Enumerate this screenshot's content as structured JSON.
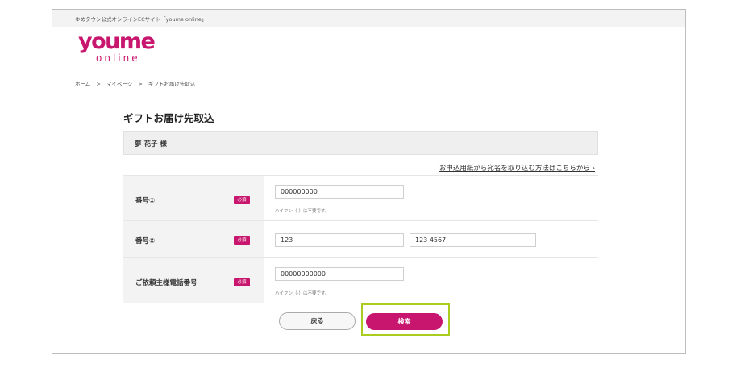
{
  "site": {
    "description": "ゆめタウン公式オンラインECサイト「youme online」",
    "logo_main": "youme",
    "logo_sub": "online"
  },
  "breadcrumb": {
    "items": [
      "ホーム",
      ">",
      "マイページ",
      ">",
      "ギフトお届け先取込"
    ]
  },
  "page": {
    "title": "ギフトお届け先取込",
    "customer_name": "夢 花子 様",
    "import_link": "お申込用紙から宛名を取り込む方法はこちらから ›"
  },
  "form": {
    "required_label": "必須",
    "number1": {
      "label": "番号①",
      "value": "000000000",
      "hint": "ハイフン（-）は不要です。"
    },
    "number2": {
      "label": "番号②",
      "value_a": "123",
      "value_b": "123 4567"
    },
    "phone": {
      "label": "ご依頼主様電話番号",
      "value": "00000000000",
      "hint": "ハイフン（-）は不要です。"
    }
  },
  "buttons": {
    "back": "戻る",
    "search": "検索"
  },
  "colors": {
    "brand": "#c8156d",
    "highlight": "#a9cc1f"
  }
}
